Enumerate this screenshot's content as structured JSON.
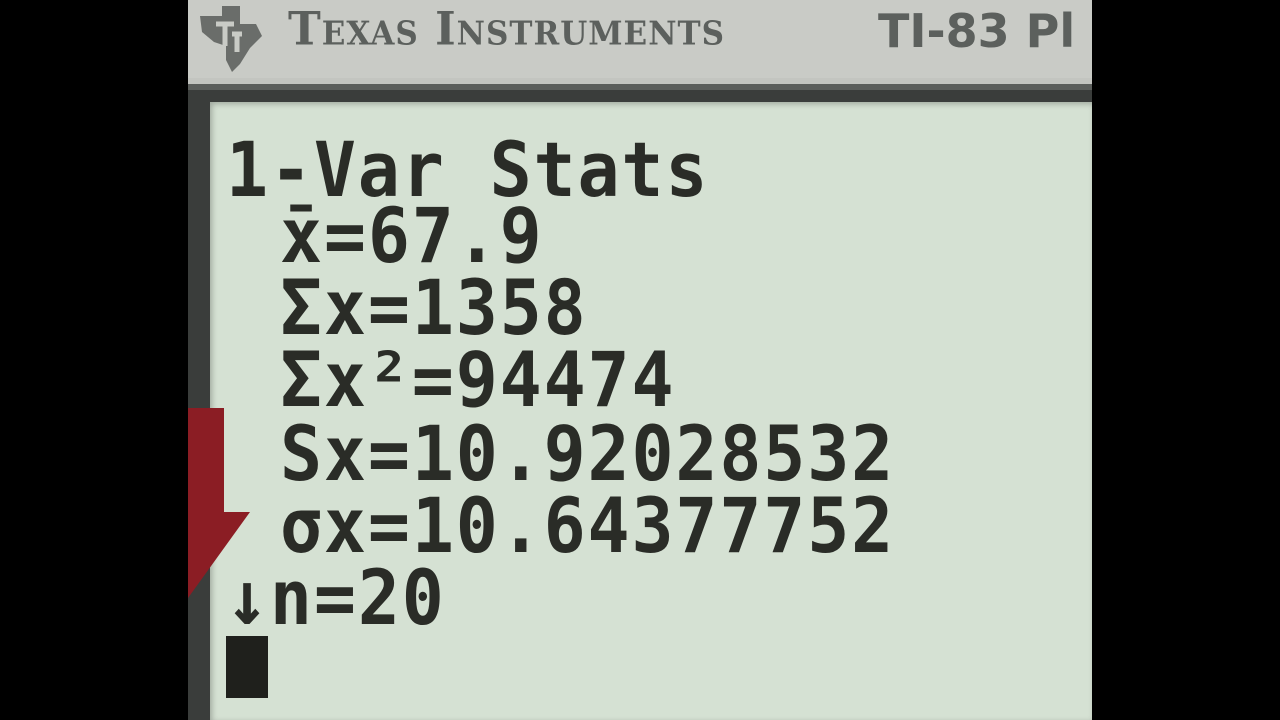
{
  "calculator": {
    "brand": "Texas Instruments",
    "model": "TI-83 Pl"
  },
  "screen": {
    "title": "1-Var Stats",
    "lines": [
      {
        "label": "x̄=",
        "value": "67.9"
      },
      {
        "label": "Σx=",
        "value": "1358"
      },
      {
        "label": "Σx²=",
        "value": "94474"
      },
      {
        "label": "Sx=",
        "value": "10.92028532"
      },
      {
        "label": "σx=",
        "value": "10.64377752"
      },
      {
        "label": "↓n=",
        "value": "20"
      }
    ]
  },
  "colors": {
    "lcd_background": "#d5e1d3",
    "lcd_text": "#2a2c27",
    "arrow": "#8b1d24",
    "bezel": "#3a3d3b"
  },
  "icons": {
    "logo": "ti-logo-icon",
    "arrow": "down-arrow-icon"
  }
}
